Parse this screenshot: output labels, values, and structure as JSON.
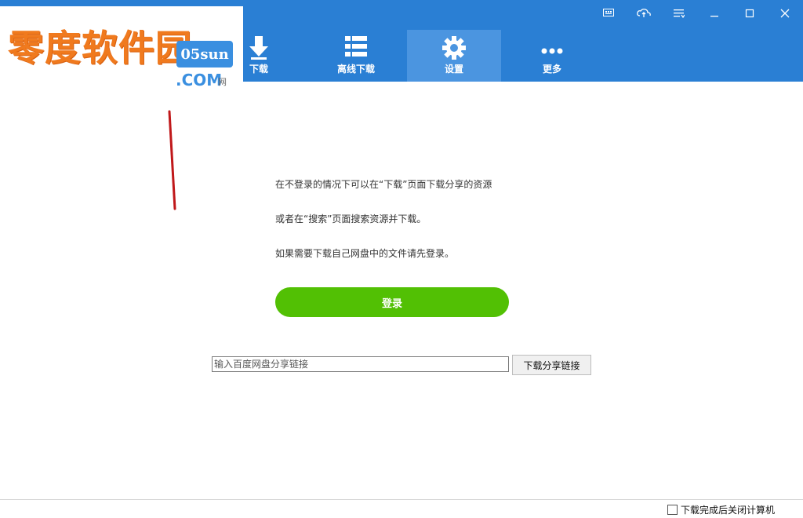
{
  "logo": {
    "text_cn": "零度软件园",
    "badge": "05sun",
    "domain": ".COM",
    "mini": "网"
  },
  "nav": {
    "items": [
      {
        "label": "下载",
        "icon": "download-arrow-icon"
      },
      {
        "label": "离线下载",
        "icon": "list-icon"
      },
      {
        "label": "设置",
        "icon": "gear-icon",
        "active": true
      },
      {
        "label": "更多",
        "icon": "more-dots-icon"
      }
    ]
  },
  "window_controls": [
    "menu-icon",
    "cloud-icon",
    "settings-list-icon",
    "minimize-icon",
    "maximize-icon",
    "close-icon"
  ],
  "intro": {
    "line1": "在不登录的情况下可以在“下载”页面下载分享的资源",
    "line2": "或者在“搜索”页面搜索资源并下载。",
    "line3": "如果需要下载自己网盘中的文件请先登录。"
  },
  "login": {
    "label": "登录"
  },
  "share": {
    "placeholder": "输入百度网盘分享链接",
    "button_label": "下载分享链接"
  },
  "footer": {
    "shutdown_label": "下载完成后关闭计算机",
    "shutdown_checked": false
  },
  "colors": {
    "header_bg": "#2a7fd4",
    "active_tab_bg": "#4b95e0",
    "login_green": "#52c004"
  }
}
